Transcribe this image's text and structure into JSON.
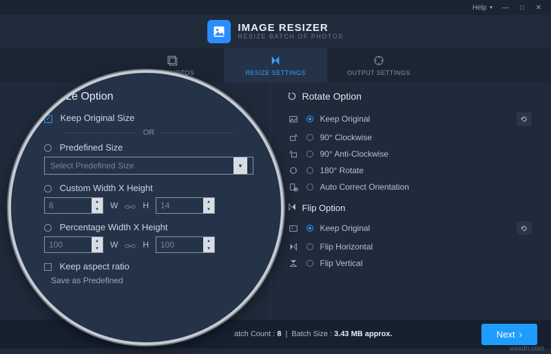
{
  "window": {
    "help": "Help",
    "min": "—",
    "max": "□",
    "close": "✕"
  },
  "brand": {
    "title": "IMAGE RESIZER",
    "subtitle": "RESIZE BATCH OF PHOTOS"
  },
  "tabs": {
    "add": "ADD PHOTOS",
    "resize": "RESIZE SETTINGS",
    "output": "OUTPUT SETTINGS"
  },
  "rotate": {
    "title": "Rotate Option",
    "keep": "Keep Original",
    "cw": "90° Clockwise",
    "acw": "90° Anti-Clockwise",
    "r180": "180° Rotate",
    "auto": "Auto Correct Orientation"
  },
  "flip": {
    "title": "Flip Option",
    "keep": "Keep Original",
    "h": "Flip Horizontal",
    "v": "Flip Vertical"
  },
  "footer": {
    "count_label": "atch Count :",
    "count_val": "8",
    "size_label": "Batch Size :",
    "size_val": "3.43 MB approx.",
    "next": "Next"
  },
  "resize": {
    "title": "Resize Option",
    "keep": "Keep Original Size",
    "or": "OR",
    "predefined": "Predefined Size",
    "select_placeholder": "Select Predefined Size",
    "custom": "Custom Width X Height",
    "width_val": "8",
    "height_val": "14",
    "w": "W",
    "h": "H",
    "percent": "Percentage Width X Height",
    "pw": "100",
    "ph": "100",
    "aspect": "Keep aspect ratio",
    "save_pre": "Save as Predefined"
  },
  "watermark": "wsxdn.com"
}
